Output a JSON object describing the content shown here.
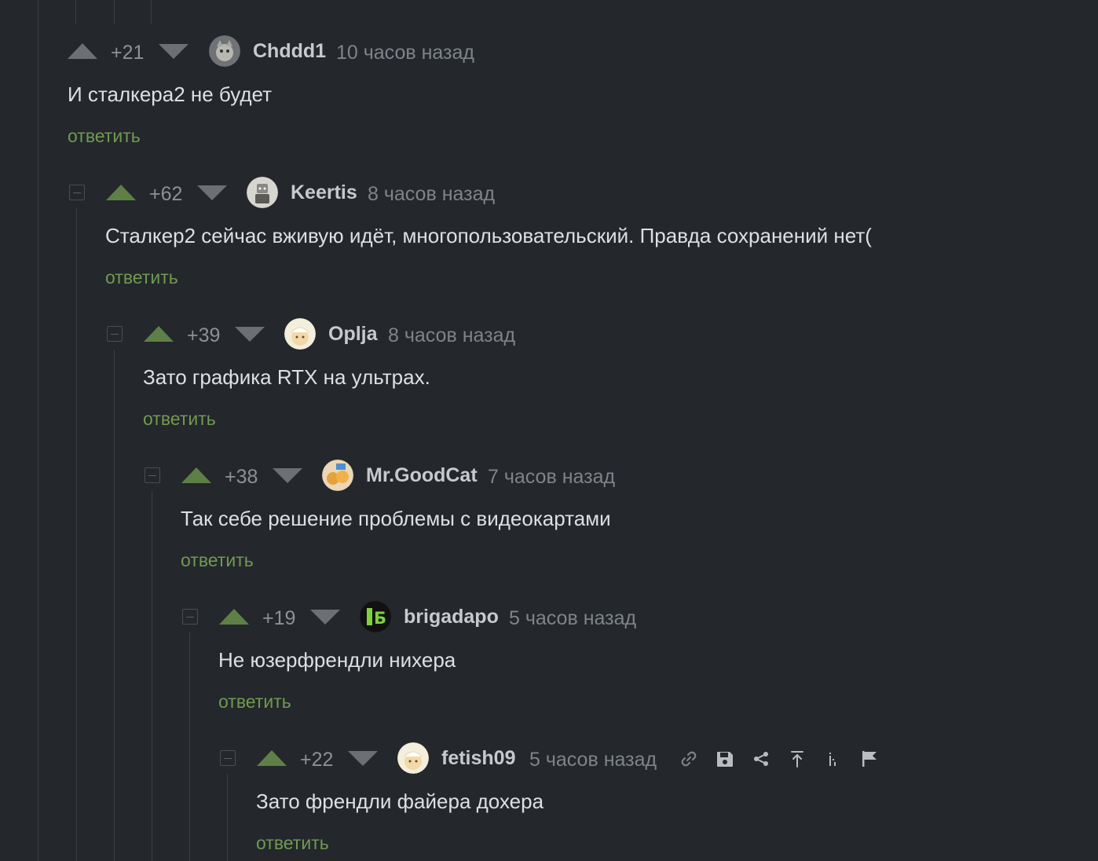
{
  "reply_label": "ответить",
  "colors": {
    "background": "#24272b",
    "reply_link": "#6f9a52",
    "vote_active": "#5e8047",
    "vote_inactive": "#6d6f72"
  },
  "comments": [
    {
      "score": "+21",
      "author": "Chddd1",
      "time": "10 часов назад",
      "text": "И сталкера2 не будет",
      "upvote_active": false,
      "avatar_icon": "cat-avatar-icon"
    },
    {
      "score": "+62",
      "author": "Keertis",
      "time": "8 часов назад",
      "text": "Сталкер2 сейчас вживую идёт, многопользовательский. Правда сохранений нет(",
      "upvote_active": true,
      "avatar_icon": "robot-avatar-icon"
    },
    {
      "score": "+39",
      "author": "Oplja",
      "time": "8 часов назад",
      "text": "Зато графика RTX на ультрах.",
      "upvote_active": true,
      "avatar_icon": "cartoon-face-avatar-icon"
    },
    {
      "score": "+38",
      "author": "Mr.GoodCat",
      "time": "7 часов назад",
      "text": "Так себе решение проблемы с видеокартами",
      "upvote_active": true,
      "avatar_icon": "cats-avatar-icon"
    },
    {
      "score": "+19",
      "author": "brigadapo",
      "time": "5 часов назад",
      "text": "Не юзерфрендли нихера",
      "upvote_active": true,
      "avatar_icon": "brigada-logo-avatar-icon",
      "avatar_text": "Б"
    },
    {
      "score": "+22",
      "author": "fetish09",
      "time": "5 часов назад",
      "text": "Зато френдли файера дохера",
      "upvote_active": true,
      "avatar_icon": "cartoon-face-avatar-icon"
    }
  ],
  "actions": [
    "link-icon",
    "save-icon",
    "share-icon",
    "go-to-parent-icon",
    "thread-icon",
    "report-flag-icon"
  ]
}
